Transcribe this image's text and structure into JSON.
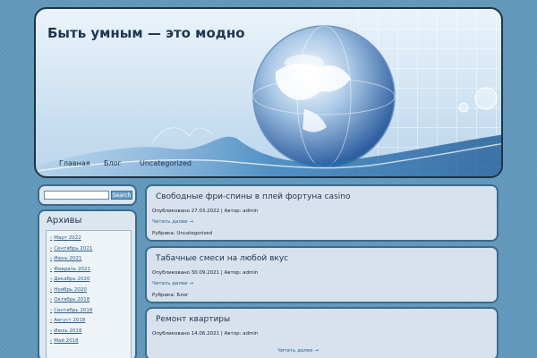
{
  "site": {
    "title": "Быть умным — это модно"
  },
  "nav": [
    "Главная",
    "Блог",
    "Uncategorized"
  ],
  "search": {
    "button": "Search",
    "value": ""
  },
  "archives": {
    "heading": "Архивы",
    "items": [
      "Март 2022",
      "Сентябрь 2021",
      "Июнь 2021",
      "Февраль 2021",
      "Декабрь 2020",
      "Ноябрь 2020",
      "Октябрь 2018",
      "Сентябрь 2018",
      "Август 2018",
      "Июль 2018",
      "Май 2018"
    ]
  },
  "posts": [
    {
      "title": "Свободные фри-спины в плей фортуна casino",
      "meta": "Опубликовано 27.03.2022 | Автор: admin",
      "more": "Читать далее →",
      "category": "Рубрика: Uncategorized"
    },
    {
      "title": "Табачные смеси на любой вкус",
      "meta": "Опубликовано 30.09.2021 | Автор: admin",
      "more": "Читать далее →",
      "category": "Рубрика: Блог"
    },
    {
      "title": "Ремонт квартиры",
      "meta": "Опубликовано 14.06.2021 | Автор: admin",
      "more": "Читать далее →"
    }
  ]
}
